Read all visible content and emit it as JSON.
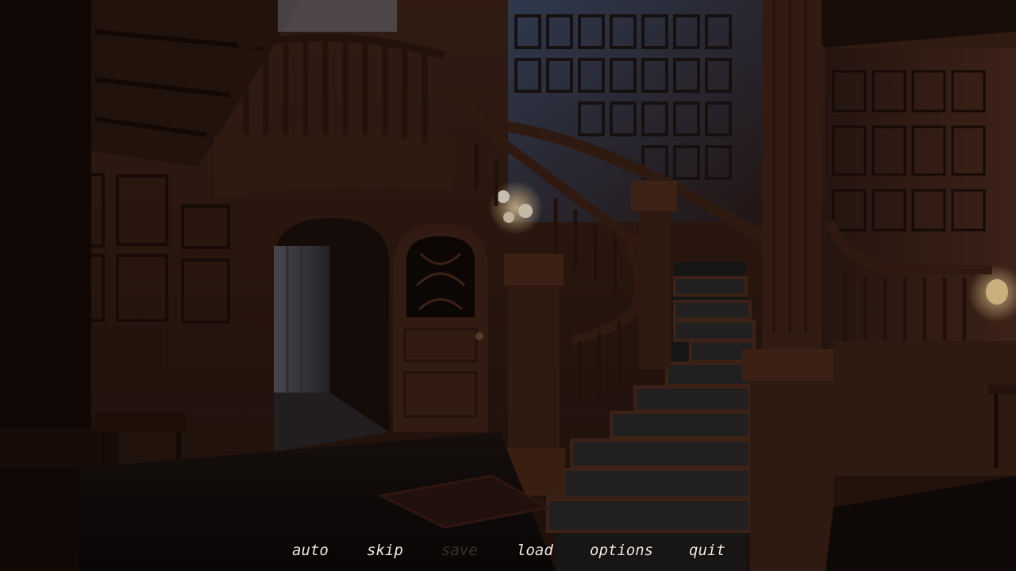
{
  "quick_menu": {
    "auto": "auto",
    "skip": "skip",
    "save": "save",
    "load": "load",
    "options": "options",
    "quit": "quit"
  },
  "quick_menu_state": {
    "save_enabled": false
  },
  "colors": {
    "menu_text": "#efe9e2",
    "menu_text_disabled": "#3a322c",
    "wood_dark": "#2a1610",
    "wood_mid": "#4a2a1c"
  },
  "scene_icons": [
    "staircase",
    "doorway",
    "wall-lamp",
    "balcony-railing",
    "newel-post"
  ]
}
